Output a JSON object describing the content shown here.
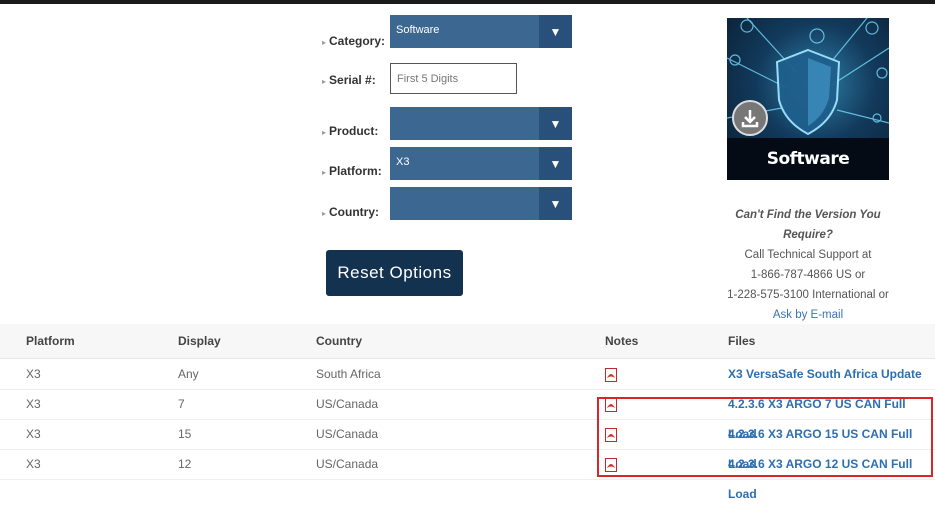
{
  "filters": {
    "category_label": "Category:",
    "category_value": "Software",
    "serial_label": "Serial #:",
    "serial_placeholder": "First 5 Digits",
    "product_label": "Product:",
    "product_value": "",
    "platform_label": "Platform:",
    "platform_value": "X3",
    "country_label": "Country:",
    "country_value": "",
    "reset_label": "Reset Options"
  },
  "promo": {
    "image_caption": "Software Download"
  },
  "support": {
    "question": "Can't Find the Version You Require?",
    "line1": "Call Technical Support at",
    "line2": "1-866-787-4866 US or",
    "line3": "1-228-575-3100 International or",
    "email_link": "Ask by E-mail"
  },
  "table": {
    "headers": [
      "Platform",
      "Display",
      "Country",
      "Notes",
      "Files"
    ],
    "rows": [
      {
        "platform": "X3",
        "display": "Any",
        "country": "South Africa",
        "file": "X3 VersaSafe South Africa Update"
      },
      {
        "platform": "X3",
        "display": "7",
        "country": "US/Canada",
        "file": "4.2.3.6 X3 ARGO 7 US CAN Full Load"
      },
      {
        "platform": "X3",
        "display": "15",
        "country": "US/Canada",
        "file": "4.2.3.6 X3 ARGO 15 US CAN Full Load"
      },
      {
        "platform": "X3",
        "display": "12",
        "country": "US/Canada",
        "file": "4.2.3.6 X3 ARGO 12 US CAN Full Load"
      }
    ]
  },
  "colors": {
    "select_bg": "#3b6791",
    "button_bg": "#13324f",
    "link": "#2d6fb0",
    "highlight": "#d9252a"
  }
}
